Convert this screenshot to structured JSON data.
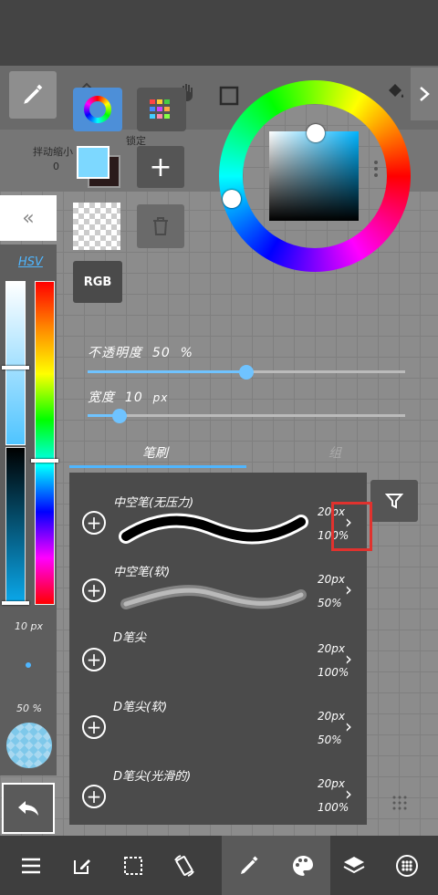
{
  "canvas": {
    "grid": true
  },
  "top_toolbar": {
    "tools": [
      "pen-icon",
      "eraser-icon",
      "fill-tool-icon",
      "hand-icon",
      "rect-select-icon",
      "bucket-icon"
    ],
    "active": "pen-icon",
    "ghost_labels": {
      "move": "拌动缩小",
      "lock": "锁定",
      "zero": "0"
    }
  },
  "color_panel": {
    "mode_buttons": [
      "color-wheel-icon",
      "palette-grid-icon"
    ],
    "foreground": "#7dd8ff",
    "background": "#2a1a1a",
    "add_label": "+",
    "rgb_label": "RGB"
  },
  "hsv_panel": {
    "label": "HSV",
    "brush_size_text": "10 px",
    "opacity_text": "50 %"
  },
  "brush_settings": {
    "opacity_label": "不透明度",
    "opacity_value": "50",
    "opacity_unit": "%",
    "opacity_fraction": 0.5,
    "width_label": "宽度",
    "width_value": "10",
    "width_unit": "px",
    "width_fraction": 0.1
  },
  "brush_tabs": [
    {
      "label": "笔刷",
      "active": true
    },
    {
      "label": "组",
      "active": false
    }
  ],
  "brushes": [
    {
      "name": "中空笔(无压力)",
      "size": "20px",
      "opacity": "100%"
    },
    {
      "name": "中空笔(软)",
      "size": "20px",
      "opacity": "50%"
    },
    {
      "name": "D笔尖",
      "size": "20px",
      "opacity": "100%"
    },
    {
      "name": "D笔尖(软)",
      "size": "20px",
      "opacity": "50%"
    },
    {
      "name": "D笔尖(光滑的)",
      "size": "20px",
      "opacity": "100%"
    }
  ],
  "bottom_nav": [
    "menu-icon",
    "edit-icon",
    "selection-icon",
    "rotate-icon",
    "pen-icon",
    "palette-icon",
    "layers-icon",
    "more-icon"
  ],
  "accent_color": "#4fb6ff",
  "highlight_color": "#e0322e"
}
